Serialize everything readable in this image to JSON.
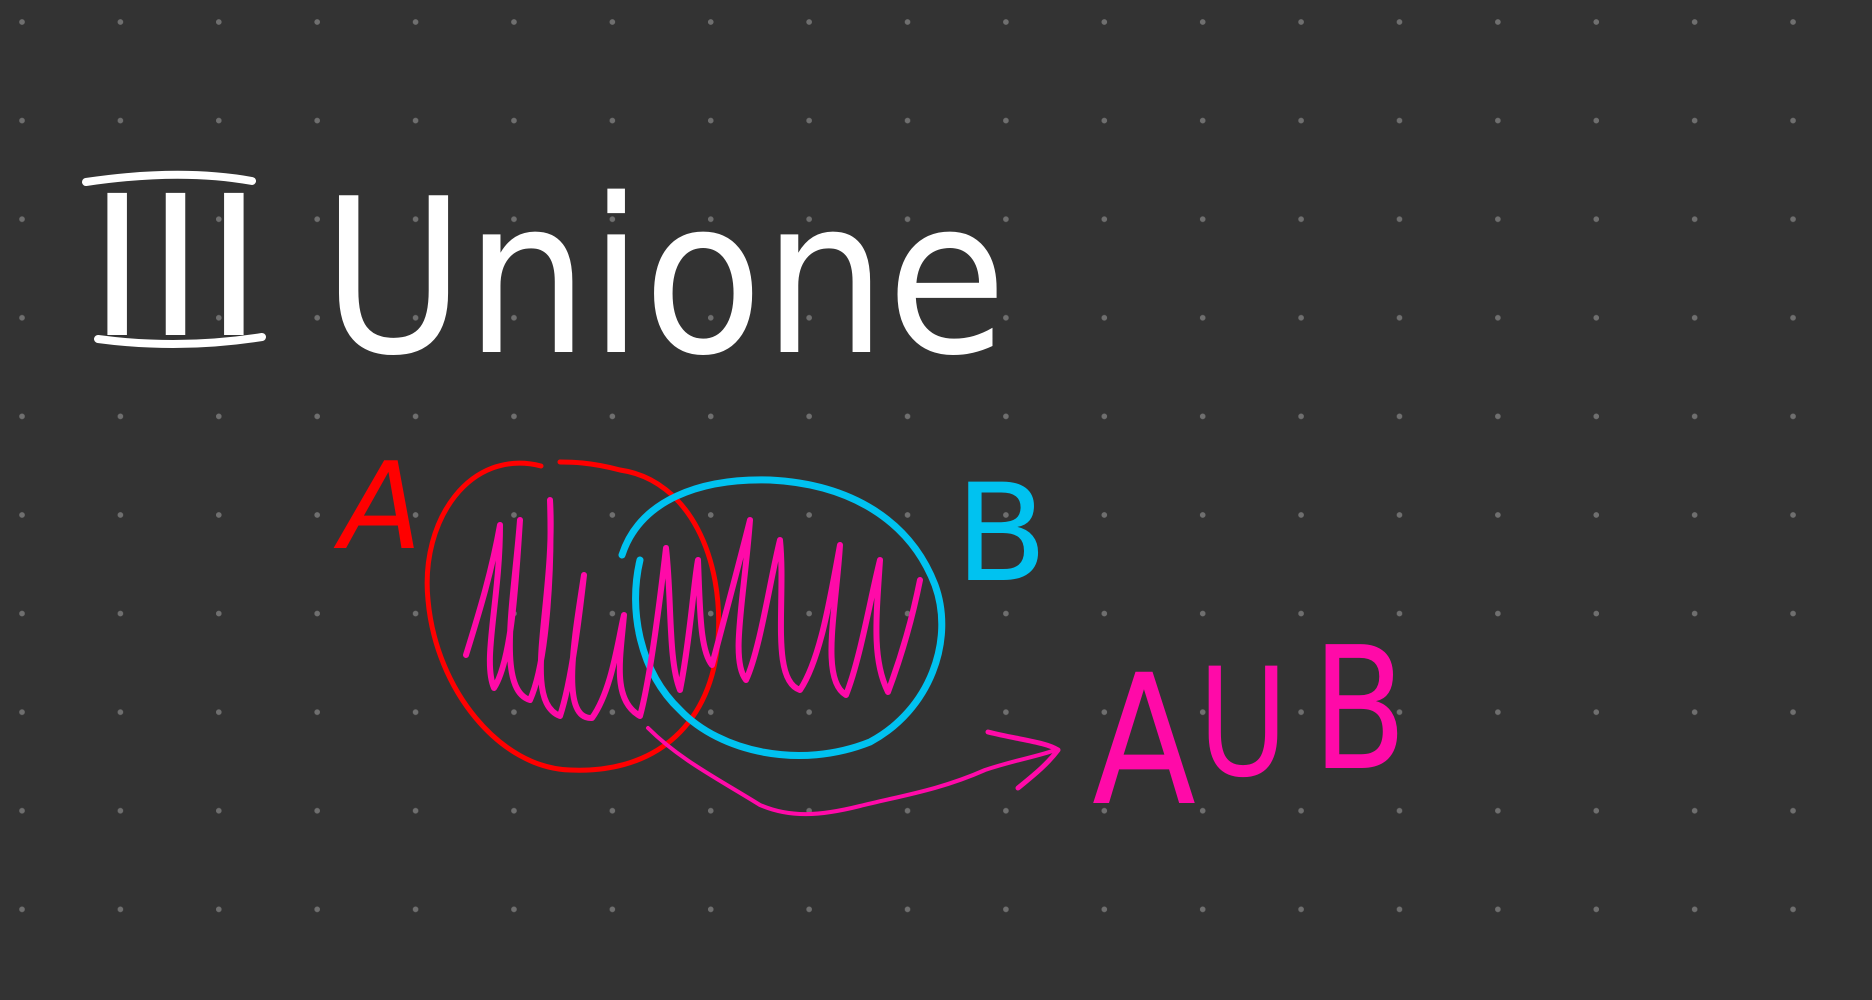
{
  "canvas": {
    "background": "#333333",
    "dot_color": "#6f6f6f",
    "grid": "dotted"
  },
  "colors": {
    "title": "#ffffff",
    "set_a": "#ff0000",
    "set_b": "#00c2f0",
    "union": "#ff0aa8"
  },
  "title": {
    "numeral": "III",
    "word": "Unione"
  },
  "labels": {
    "set_a": "A",
    "set_b": "B",
    "union_prefix": "A",
    "union_symbol": "U",
    "union_suffix": "B"
  },
  "icons": [
    "arrow-right-icon"
  ]
}
